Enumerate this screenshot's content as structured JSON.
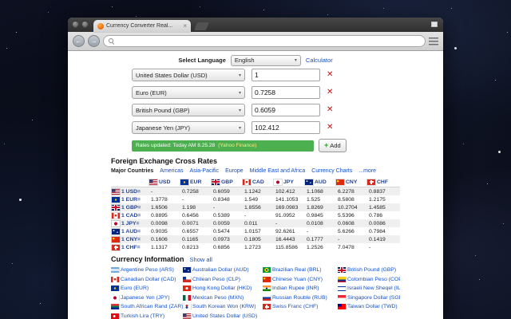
{
  "icons": {
    "close": "×",
    "back": "←",
    "forward": "→",
    "select_arrow": "▾",
    "remove": "✕",
    "plus": "+"
  },
  "colors": {
    "rates_bar_green": "#4caf50",
    "link_blue": "#1550c8",
    "remove_red": "#cc1111",
    "rates_source_yellow": "#ffe97a",
    "header_blue": "#23418f"
  },
  "browser": {
    "tab_title": "Currency Converter Real..."
  },
  "converter": {
    "select_language_label": "Select Language",
    "language_selected": "English",
    "calculator_label": "Calculator",
    "rows": [
      {
        "currency": "United States Dollar (USD)",
        "value": "1"
      },
      {
        "currency": "Euro (EUR)",
        "value": "0.7258"
      },
      {
        "currency": "British Pound (GBP)",
        "value": "0.6059"
      },
      {
        "currency": "Japanese Yen (JPY)",
        "value": "102.412"
      }
    ],
    "rates_updated": "Rates updated: Today AM 8.25.28",
    "rates_source": "(Yahoo Finance)",
    "add_label": "Add"
  },
  "cross_rates": {
    "title": "Foreign Exchange Cross Rates",
    "tabs": [
      {
        "label": "Major Countries",
        "selected": true
      },
      {
        "label": "Americas"
      },
      {
        "label": "Asia-Pacific"
      },
      {
        "label": "Europe"
      },
      {
        "label": "Middle East and Africa"
      },
      {
        "label": "Currency Charts"
      },
      {
        "label": "...more"
      }
    ],
    "columns": [
      {
        "code": "USD",
        "flag": "us"
      },
      {
        "code": "EUR",
        "flag": "eu"
      },
      {
        "code": "GBP",
        "flag": "gb"
      },
      {
        "code": "CAD",
        "flag": "ca"
      },
      {
        "code": "JPY",
        "flag": "jp"
      },
      {
        "code": "AUD",
        "flag": "au"
      },
      {
        "code": "CNY",
        "flag": "cn"
      },
      {
        "code": "CHF",
        "flag": "ch"
      }
    ],
    "rows": [
      {
        "label": "1 USD=",
        "flag": "us",
        "values": [
          "-",
          "0.7258",
          "0.6059",
          "1.1242",
          "102.412",
          "1.1068",
          "6.2278",
          "0.8837"
        ]
      },
      {
        "label": "1 EUR=",
        "flag": "eu",
        "values": [
          "1.3778",
          "-",
          "0.8348",
          "1.549",
          "141.1053",
          "1.525",
          "8.5808",
          "1.2175"
        ]
      },
      {
        "label": "1 GBP=",
        "flag": "gb",
        "values": [
          "1.6506",
          "1.198",
          "-",
          "1.8556",
          "169.0983",
          "1.8269",
          "10.2704",
          "1.4585"
        ]
      },
      {
        "label": "1 CAD=",
        "flag": "ca",
        "values": [
          "0.8895",
          "0.6456",
          "0.5389",
          "-",
          "91.0952",
          "0.9845",
          "5.5396",
          "0.786"
        ]
      },
      {
        "label": "1 JPY=",
        "flag": "jp",
        "values": [
          "0.0098",
          "0.0071",
          "0.0059",
          "0.011",
          "-",
          "0.0108",
          "0.0608",
          "0.0086"
        ]
      },
      {
        "label": "1 AUD=",
        "flag": "au",
        "values": [
          "0.9035",
          "0.6557",
          "0.5474",
          "1.0157",
          "92.6261",
          "-",
          "5.6266",
          "0.7984"
        ]
      },
      {
        "label": "1 CNY=",
        "flag": "cn",
        "values": [
          "0.1606",
          "0.1165",
          "0.0973",
          "0.1805",
          "16.4443",
          "0.1777",
          "-",
          "0.1419"
        ]
      },
      {
        "label": "1 CHF=",
        "flag": "ch",
        "values": [
          "1.1317",
          "0.8213",
          "0.6856",
          "1.2723",
          "115.8586",
          "1.2526",
          "7.0478",
          "-"
        ]
      }
    ]
  },
  "currency_info": {
    "title": "Currency Information",
    "show_all_label": "Show all",
    "items": [
      {
        "label": "Argentine Peso (ARS)",
        "flag": "ar"
      },
      {
        "label": "Australian Dollar (AUD)",
        "flag": "au"
      },
      {
        "label": "Brazilian Real (BRL)",
        "flag": "br"
      },
      {
        "label": "British Pound (GBP)",
        "flag": "gb"
      },
      {
        "label": "Canadian Dollar (CAD)",
        "flag": "ca"
      },
      {
        "label": "Chilean Peso (CLP)",
        "flag": "cl"
      },
      {
        "label": "Chinese Yuan (CNY)",
        "flag": "cn"
      },
      {
        "label": "Colombian Peso (COP)",
        "flag": "co"
      },
      {
        "label": "Euro (EUR)",
        "flag": "eu"
      },
      {
        "label": "Hong Kong Dollar (HKD)",
        "flag": "hk"
      },
      {
        "label": "Indian Rupee (INR)",
        "flag": "in"
      },
      {
        "label": "Israeli New Sheqel (ILS)",
        "flag": "il"
      },
      {
        "label": "Japanese Yen (JPY)",
        "flag": "jp"
      },
      {
        "label": "Mexican Peso (MXN)",
        "flag": "mx"
      },
      {
        "label": "Russian Rouble (RUB)",
        "flag": "ru"
      },
      {
        "label": "Singapore Dollar (SGD)",
        "flag": "sg"
      },
      {
        "label": "South African Rand (ZAR)",
        "flag": "za"
      },
      {
        "label": "South Korean Won (KRW)",
        "flag": "kr"
      },
      {
        "label": "Swiss Franc (CHF)",
        "flag": "ch"
      },
      {
        "label": "Taiwan Dollar (TWD)",
        "flag": "tw"
      },
      {
        "label": "Turkish Lira (TRY)",
        "flag": "tr"
      },
      {
        "label": "United States Dollar (USD)",
        "flag": "us"
      }
    ]
  }
}
